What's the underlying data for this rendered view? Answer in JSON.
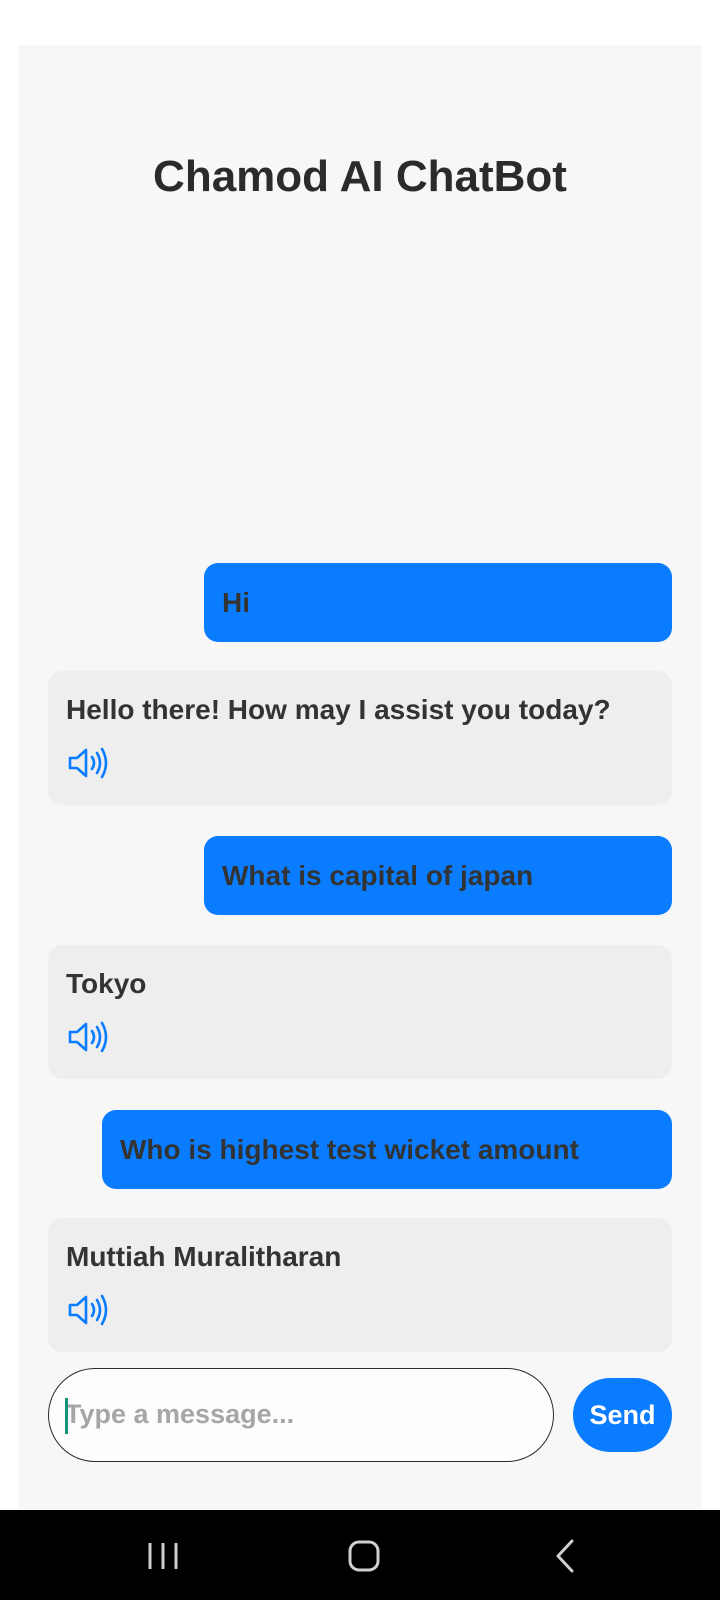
{
  "app": {
    "title": "Chamod AI ChatBot"
  },
  "messages": [
    {
      "role": "user",
      "text": "Hi"
    },
    {
      "role": "bot",
      "text": "Hello there! How may I assist you today?",
      "icon": "speaker-icon"
    },
    {
      "role": "user",
      "text": "What is capital of japan"
    },
    {
      "role": "bot",
      "text": "Tokyo",
      "icon": "speaker-icon"
    },
    {
      "role": "user",
      "text": "Who is highest test wicket amount"
    },
    {
      "role": "bot",
      "text": "Muttiah Muralitharan",
      "icon": "speaker-icon"
    }
  ],
  "composer": {
    "placeholder": "Type a message...",
    "value": "",
    "send_label": "Send"
  },
  "navbar": {
    "icons": [
      "recent-apps-icon",
      "home-icon",
      "back-icon"
    ]
  },
  "colors": {
    "accent": "#0a7cff",
    "bot_bubble": "#eeeeef",
    "background": "#f7f7f8",
    "text": "#333333"
  }
}
